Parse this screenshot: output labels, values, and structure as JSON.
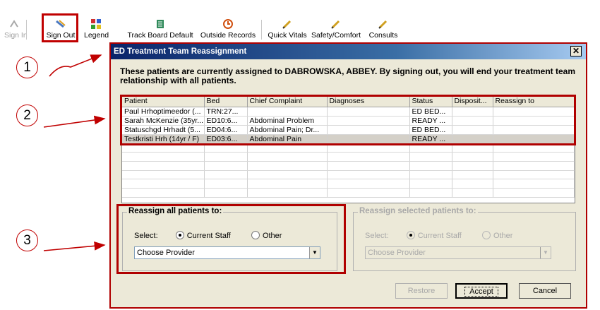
{
  "toolbar": {
    "buttons": [
      {
        "label": "Sign In",
        "icon": "sign-in-icon",
        "enabled": false
      },
      {
        "label": "Sign Out",
        "icon": "sign-out-icon",
        "enabled": true
      },
      {
        "label": "Legend",
        "icon": "legend-icon",
        "enabled": true
      },
      {
        "label": "Track Board Default",
        "icon": "track-board-icon",
        "enabled": true
      },
      {
        "label": "Outside Records",
        "icon": "outside-records-icon",
        "enabled": true
      },
      {
        "label": "Quick Vitals",
        "icon": "pencil-icon",
        "enabled": true
      },
      {
        "label": "Safety/Comfort",
        "icon": "pencil-icon",
        "enabled": true
      },
      {
        "label": "Consults",
        "icon": "pencil-icon",
        "enabled": true
      }
    ]
  },
  "dialog": {
    "title": "ED Treatment Team Reassignment",
    "close_glyph": "✕",
    "message": "These patients are currently assigned to DABROWSKA, ABBEY. By signing out, you will end your treatment team relationship with all patients.",
    "table": {
      "columns": [
        "Patient",
        "Bed",
        "Chief Complaint",
        "Diagnoses",
        "Status",
        "Disposit...",
        "Reassign to"
      ],
      "rows": [
        [
          "Paul Hrhoptimeedor (...",
          "TRN:27...",
          "",
          "",
          "ED BED...",
          "",
          ""
        ],
        [
          "Sarah McKenzie (35yr...",
          "ED10:6...",
          "Abdominal Problem",
          "",
          "READY ...",
          "",
          ""
        ],
        [
          "Statuschgd Hrhadt (5...",
          "ED04:6...",
          "Abdominal Pain; Dr...",
          "",
          "ED BED...",
          "",
          ""
        ],
        [
          "Testkristi Hrh (14yr / F)",
          "ED03:6...",
          "Abdominal Pain",
          "",
          "READY ...",
          "",
          ""
        ]
      ]
    },
    "reassign_all": {
      "title": "Reassign all patients to:",
      "select_label": "Select:",
      "option_current": "Current Staff",
      "option_other": "Other",
      "dropdown_value": "Choose Provider"
    },
    "reassign_selected": {
      "title": "Reassign selected patients to:",
      "select_label": "Select:",
      "option_current": "Current Staff",
      "option_other": "Other",
      "dropdown_value": "Choose Provider"
    },
    "buttons": {
      "restore": "Restore",
      "accept": "Accept",
      "cancel": "Cancel"
    }
  },
  "annotations": [
    "1",
    "2",
    "3"
  ],
  "colors": {
    "highlight": "#c00000",
    "title_bar_start": "#0a246a",
    "title_bar_end": "#a6caf0",
    "dialog_bg": "#ece9d8"
  }
}
